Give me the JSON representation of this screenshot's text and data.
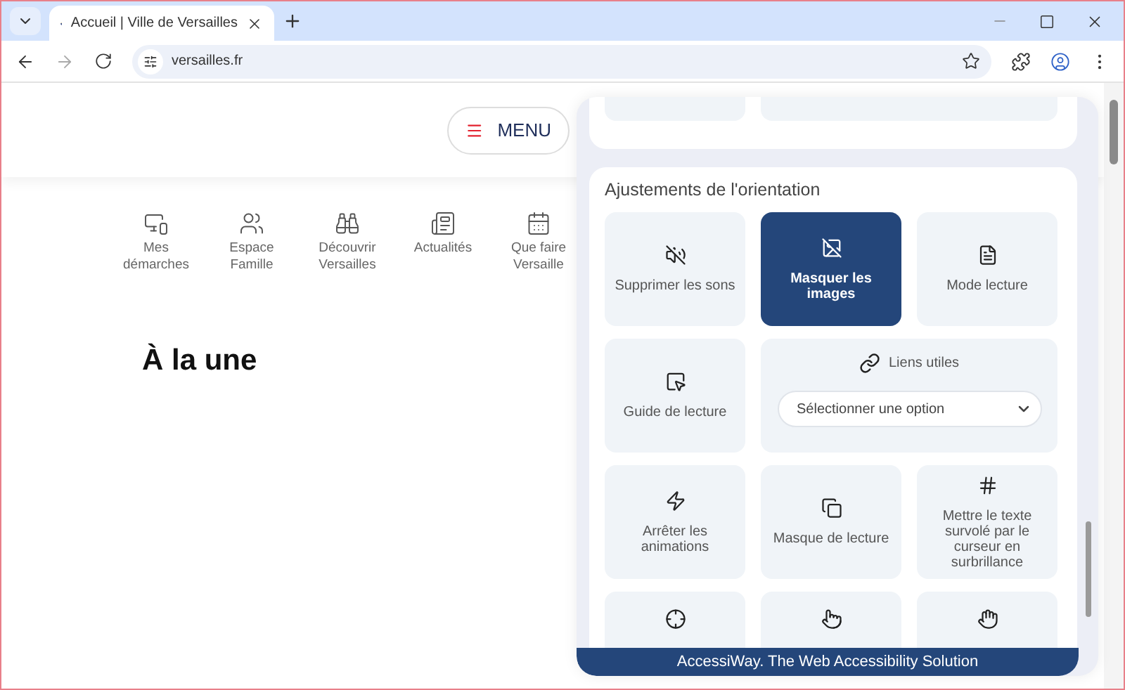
{
  "browser": {
    "tab": {
      "title": "Accueil | Ville de Versailles"
    },
    "address": "versailles.fr"
  },
  "header": {
    "menu_label": "MENU"
  },
  "nav": [
    {
      "lines": [
        "Mes",
        "démarches"
      ]
    },
    {
      "lines": [
        "Espace",
        "Famille"
      ]
    },
    {
      "lines": [
        "Découvrir",
        "Versailles"
      ]
    },
    {
      "lines": [
        "Actualités"
      ]
    },
    {
      "lines": [
        "Que faire",
        "Versaille"
      ]
    }
  ],
  "heading": "À la une",
  "panel": {
    "section_title": "Ajustements de l'orientation",
    "tiles": [
      {
        "kind": "toggle",
        "label": "Supprimer les sons",
        "selected": false
      },
      {
        "kind": "toggle",
        "label": "Masquer les images",
        "selected": true
      },
      {
        "kind": "toggle",
        "label": "Mode lecture",
        "selected": false
      },
      {
        "kind": "toggle",
        "label": "Guide de lecture",
        "selected": false
      },
      {
        "kind": "select",
        "label": "Liens utiles",
        "placeholder": "Sélectionner une option"
      },
      {
        "kind": "toggle",
        "label": "Arrêter les animations",
        "selected": false
      },
      {
        "kind": "toggle",
        "label": "Masque de lecture",
        "selected": false
      },
      {
        "kind": "toggle",
        "label": "Mettre le texte survolé par le curseur en surbrillance",
        "selected": false
      },
      {
        "kind": "toggle",
        "selected": false
      },
      {
        "kind": "toggle",
        "selected": false
      },
      {
        "kind": "toggle",
        "selected": false
      }
    ],
    "footer": "AccessiWay. The Web Accessibility Solution"
  }
}
